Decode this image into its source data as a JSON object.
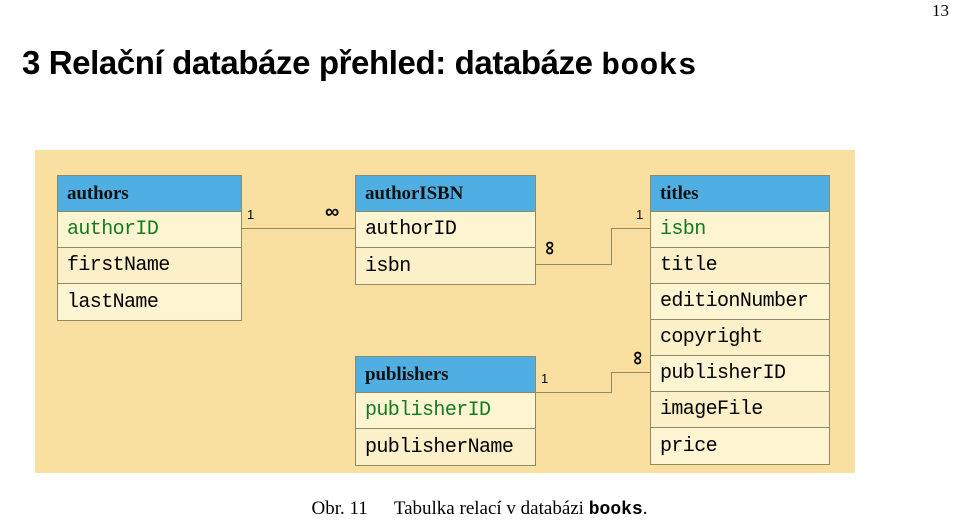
{
  "page_number": "13",
  "title": {
    "text": "3 Relační databáze přehled: databáze ",
    "mono_suffix": "books"
  },
  "caption": {
    "label": "Obr. 11",
    "text": "Tabulka relací v databázi ",
    "mono": "books",
    "period": "."
  },
  "colors": {
    "panel_background": "#FAE0A0",
    "table_header": "#4FAEE2",
    "table_cell": "#FDF5D2",
    "table_cell_alt": "#FBF0C8",
    "border": "#8E8A62",
    "primary_key_text": "#127B22",
    "field_text": "#000000"
  },
  "diagram": {
    "type": "entity-relationship",
    "tables": [
      {
        "id": "authors",
        "name": "authors",
        "fields": [
          {
            "name": "authorID",
            "key": "primary"
          },
          {
            "name": "firstName",
            "key": "none"
          },
          {
            "name": "lastName",
            "key": "none"
          }
        ]
      },
      {
        "id": "authorISBN",
        "name": "authorISBN",
        "fields": [
          {
            "name": "authorID",
            "key": "none"
          },
          {
            "name": "isbn",
            "key": "none"
          }
        ]
      },
      {
        "id": "publishers",
        "name": "publishers",
        "fields": [
          {
            "name": "publisherID",
            "key": "primary"
          },
          {
            "name": "publisherName",
            "key": "none"
          }
        ]
      },
      {
        "id": "titles",
        "name": "titles",
        "fields": [
          {
            "name": "isbn",
            "key": "primary"
          },
          {
            "name": "title",
            "key": "none"
          },
          {
            "name": "editionNumber",
            "key": "none"
          },
          {
            "name": "copyright",
            "key": "none"
          },
          {
            "name": "publisherID",
            "key": "none"
          },
          {
            "name": "imageFile",
            "key": "none"
          },
          {
            "name": "price",
            "key": "none"
          }
        ]
      }
    ],
    "relationships": [
      {
        "id": "authors-authorISBN",
        "from": "authors.authorID",
        "to": "authorISBN.authorID",
        "from_cardinality": "1",
        "to_cardinality": "∞"
      },
      {
        "id": "authorISBN-titles",
        "from": "authorISBN.isbn",
        "to": "titles.isbn",
        "from_cardinality": "∞",
        "to_cardinality": "1"
      },
      {
        "id": "publishers-titles",
        "from": "publishers.publisherID",
        "to": "titles.publisherID",
        "from_cardinality": "1",
        "to_cardinality": "∞"
      }
    ]
  }
}
